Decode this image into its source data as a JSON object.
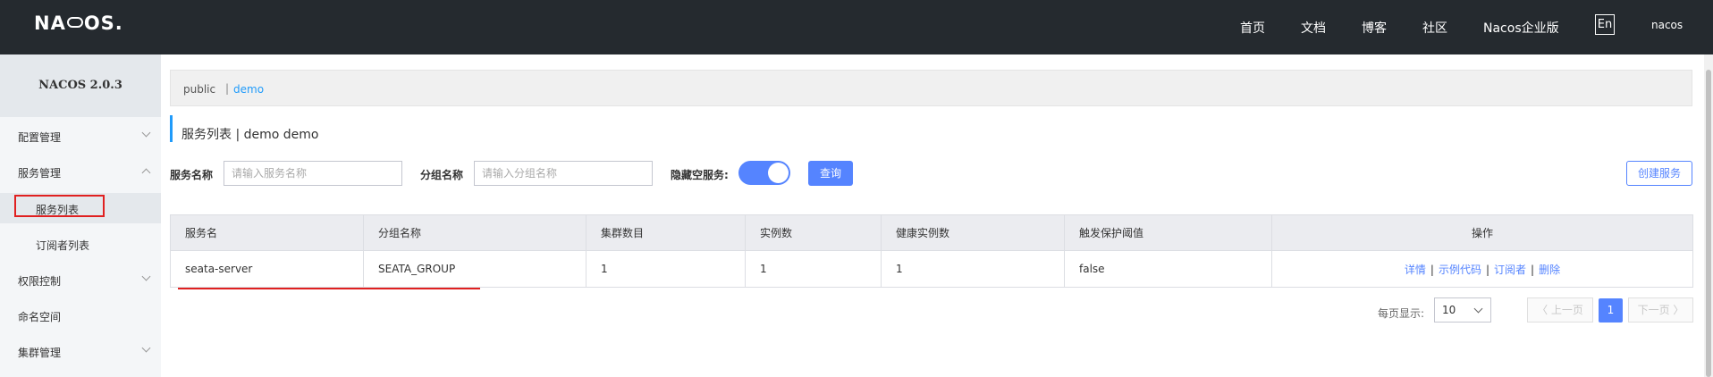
{
  "header": {
    "logo": "NACOS.",
    "nav": [
      "首页",
      "文档",
      "博客",
      "社区",
      "Nacos企业版"
    ],
    "lang": "En",
    "user": "nacos"
  },
  "sidebar": {
    "version": "NACOS 2.0.3",
    "items": [
      {
        "label": "配置管理",
        "state": "collapsed"
      },
      {
        "label": "服务管理",
        "state": "expanded"
      },
      {
        "label": "服务列表",
        "sub": true,
        "active": true
      },
      {
        "label": "订阅者列表",
        "sub": true
      },
      {
        "label": "权限控制",
        "state": "collapsed"
      },
      {
        "label": "命名空间"
      },
      {
        "label": "集群管理",
        "state": "collapsed"
      }
    ]
  },
  "namespace": {
    "items": [
      "public",
      "demo"
    ],
    "separator": "|",
    "selected": "demo"
  },
  "page": {
    "title": "服务列表  |  demo  demo"
  },
  "filters": {
    "service_name_label": "服务名称",
    "service_name_placeholder": "请输入服务名称",
    "group_name_label": "分组名称",
    "group_name_placeholder": "请输入分组名称",
    "hide_empty_label": "隐藏空服务:",
    "hide_empty_on": true,
    "query_label": "查询",
    "create_label": "创建服务"
  },
  "table": {
    "columns": [
      "服务名",
      "分组名称",
      "集群数目",
      "实例数",
      "健康实例数",
      "触发保护阈值",
      "操作"
    ],
    "rows": [
      {
        "service": "seata-server",
        "group": "SEATA_GROUP",
        "clusters": "1",
        "instances": "1",
        "healthy": "1",
        "threshold": "false",
        "ops": [
          "详情",
          "示例代码",
          "订阅者",
          "删除"
        ]
      }
    ]
  },
  "pagination": {
    "page_size_label": "每页显示:",
    "page_size": "10",
    "prev": "〈 上一页",
    "current": "1",
    "next": "下一页 〉"
  },
  "colors": {
    "header_bg": "#252a2f",
    "accent": "#5584ff",
    "ns_active": "#209bfa",
    "highlight_box": "#e02020"
  }
}
